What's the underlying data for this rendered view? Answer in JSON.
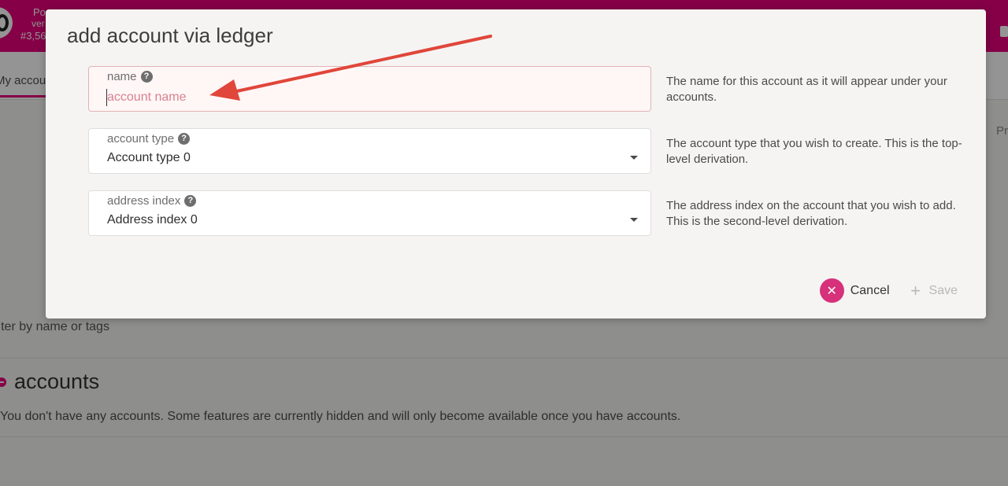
{
  "background": {
    "chain_name": "Po",
    "chain_version": "ver",
    "block_number": "#3,56",
    "nav_tab": "My accou",
    "right_partial_text": "Pr",
    "filter_placeholder": "ilter by name or tags",
    "accounts_heading": "accounts",
    "empty_message": "You don't have any accounts. Some features are currently hidden and will only become available once you have accounts."
  },
  "modal": {
    "title": "add account via ledger",
    "fields": {
      "name": {
        "label": "name",
        "placeholder": "account name",
        "value": "",
        "help": "The name for this account as it will appear under your accounts."
      },
      "account_type": {
        "label": "account type",
        "value": "Account type 0",
        "help": "The account type that you wish to create. This is the top-level derivation."
      },
      "address_index": {
        "label": "address index",
        "value": "Address index 0",
        "help": "The address index on the account that you wish to add. This is the second-level derivation."
      }
    },
    "actions": {
      "cancel_label": "Cancel",
      "save_label": "Save"
    }
  },
  "icons": {
    "help": "?",
    "close": "✕",
    "plus": "+"
  },
  "colors": {
    "brand": "#e6007a",
    "cancel_button": "#d6317a",
    "error_background": "#fff6f6",
    "error_border": "#e0b4b4",
    "annotation_arrow": "#e0463a"
  }
}
